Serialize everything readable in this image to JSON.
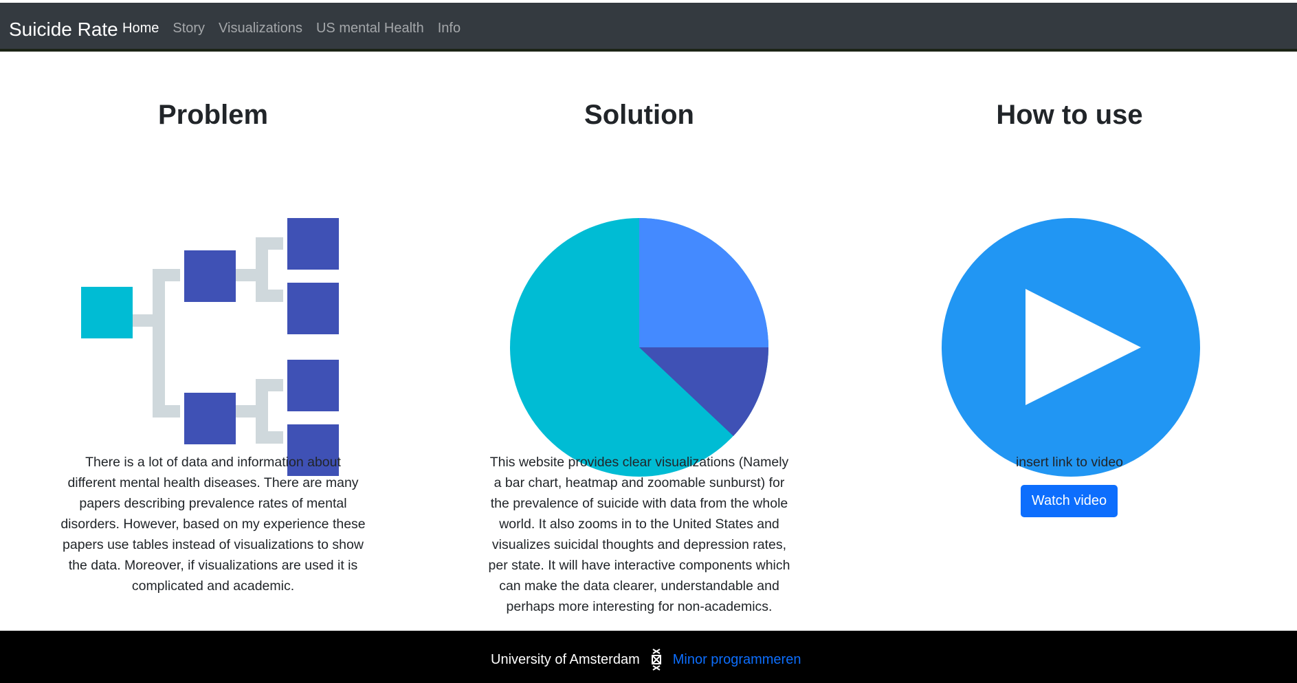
{
  "nav": {
    "brand": "Suicide Rate",
    "links": [
      "Home",
      "Story",
      "Visualizations",
      "US mental Health",
      "Info"
    ]
  },
  "sections": {
    "problem": {
      "title": "Problem",
      "lines": [
        "There is a lot of data and information about",
        "different mental health diseases. There are many",
        "papers describing prevalence rates of mental",
        "disorders. However, based on my experience these",
        "papers use tables instead of visualizations to show",
        "the data. Moreover, if visualizations are used it is",
        "complicated and academic."
      ],
      "icon": "hierarchy-tree-icon"
    },
    "solution": {
      "title": "Solution",
      "lines": [
        "This website provides clear visualizations (Namely",
        "a bar chart, heatmap and zoomable sunburst) for",
        "the prevalence of suicide with data from the whole",
        "world. It also zooms in to the United States and",
        "visualizes suicidal thoughts and depression rates,",
        "per state. It will have interactive components which",
        "can make the data clearer, understandable and",
        "perhaps more interesting for non-academics."
      ],
      "icon": "pie-chart-icon"
    },
    "howto": {
      "title": "How to use",
      "text": "insert link to video",
      "button": "Watch video",
      "icon": "play-icon"
    }
  },
  "footer": {
    "university": "University of Amsterdam",
    "logo": "uva-logo-icon",
    "link": "Minor programmeren"
  },
  "colors": {
    "navbar": "#343a40",
    "accent_blue": "#0d6efd",
    "teal": "#00bcd4",
    "indigo": "#3f51b5",
    "light_blue": "#448aff",
    "play_blue": "#2196f3",
    "connector_gray": "#cfd8dc"
  }
}
